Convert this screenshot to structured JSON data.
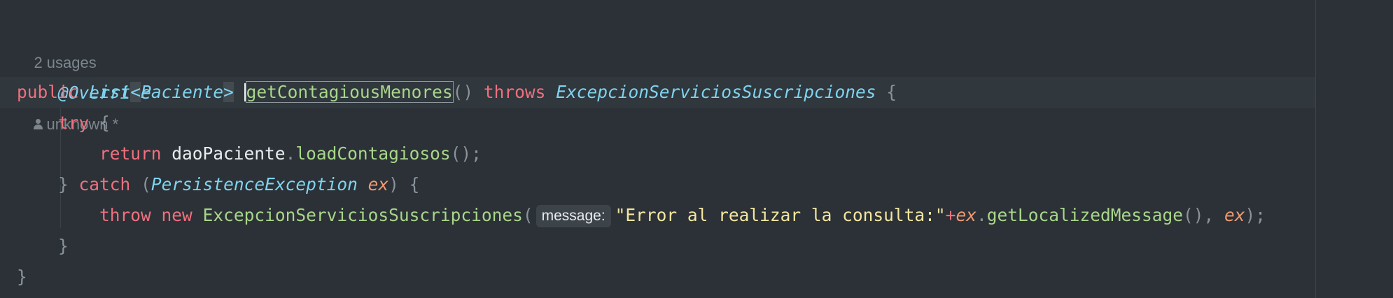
{
  "editor": {
    "meta": {
      "usages": "2 usages",
      "author": "unknown *"
    },
    "lines": {
      "annotation": "@Override",
      "l2": {
        "public": "public",
        "list": "List",
        "lt": "<",
        "paciente": "Paciente",
        "gt": ">",
        "method": "getContagiousMenores",
        "parens": "()",
        "throws": "throws",
        "exc": "ExcepcionServiciosSuscripciones",
        "brace": "{"
      },
      "l3": {
        "try": "try",
        "brace": "{"
      },
      "l4": {
        "return": "return",
        "dao": "daoPaciente",
        "dot": ".",
        "call": "loadContagiosos",
        "end": "();"
      },
      "l5": {
        "close": "}",
        "catch": "catch",
        "open": "(",
        "type": "PersistenceException",
        "var": "ex",
        "close2": ")",
        "brace": "{"
      },
      "l6": {
        "throw": "throw",
        "new": "new",
        "ctor": "ExcepcionServiciosSuscripciones",
        "open": "(",
        "hint": "message:",
        "str": "\"Error al realizar la consulta:\"",
        "plus": "+",
        "ex": "ex",
        "dot": ".",
        "call": "getLocalizedMessage",
        "parens": "()",
        "comma": ",",
        "ex2": "ex",
        "end": ");"
      },
      "l7": {
        "brace": "}"
      },
      "l8": {
        "brace": "}"
      }
    }
  }
}
